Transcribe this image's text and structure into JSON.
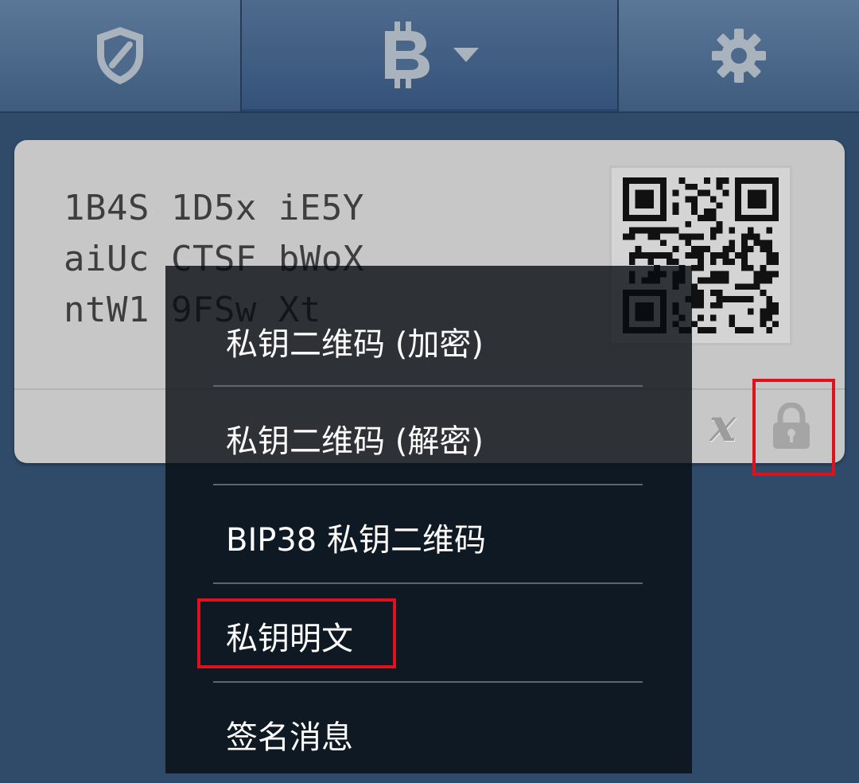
{
  "topbar": {
    "tabs": [
      {
        "id": "security",
        "icon": "shield-icon"
      },
      {
        "id": "currency",
        "icon": "bitcoin-icon",
        "dropdown": true
      },
      {
        "id": "settings",
        "icon": "gear-icon"
      }
    ]
  },
  "wallet": {
    "address_lines": [
      "1B4S 1D5x iE5Y",
      "aiUc CTSF bWoX",
      "ntW1 9FSw Xt"
    ],
    "qr_icon": "qr-code-icon",
    "actions": [
      {
        "id": "delete",
        "label": "x",
        "icon": "close-x-icon"
      },
      {
        "id": "lock",
        "icon": "lock-icon",
        "highlighted": true
      }
    ]
  },
  "menu": {
    "items": [
      {
        "label": "私钥二维码 (加密)"
      },
      {
        "label": "私钥二维码 (解密)"
      },
      {
        "label": "BIP38 私钥二维码"
      },
      {
        "label": "私钥明文",
        "highlighted": true
      },
      {
        "label": "签名消息"
      }
    ]
  },
  "colors": {
    "background": "#2f4b69",
    "card": "#c7c7c7",
    "menu": "#0b1016",
    "highlight": "#e0101c",
    "icon_gray": "#a9b3bd"
  }
}
